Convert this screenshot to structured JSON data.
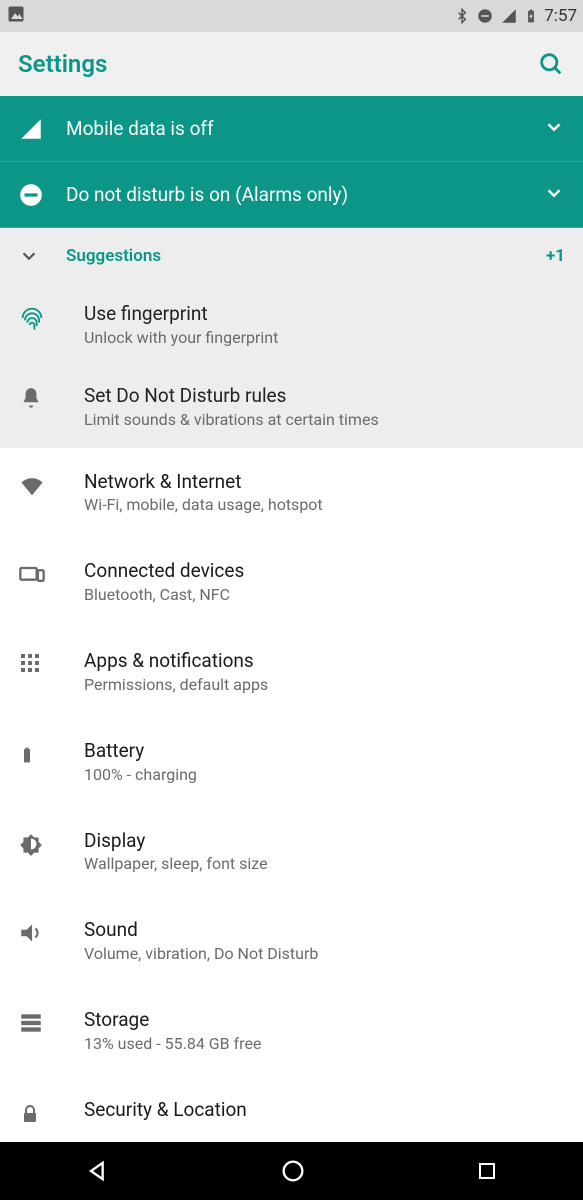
{
  "status": {
    "time": "7:57"
  },
  "header": {
    "title": "Settings"
  },
  "banners": [
    {
      "text": "Mobile data is off"
    },
    {
      "text": "Do not disturb is on (Alarms only)"
    }
  ],
  "suggestions": {
    "label": "Suggestions",
    "more": "+1",
    "items": [
      {
        "title": "Use fingerprint",
        "subtitle": "Unlock with your fingerprint"
      },
      {
        "title": "Set Do Not Disturb rules",
        "subtitle": "Limit sounds & vibrations at certain times"
      }
    ]
  },
  "settings": [
    {
      "title": "Network & Internet",
      "subtitle": "Wi-Fi, mobile, data usage, hotspot"
    },
    {
      "title": "Connected devices",
      "subtitle": "Bluetooth, Cast, NFC"
    },
    {
      "title": "Apps & notifications",
      "subtitle": "Permissions, default apps"
    },
    {
      "title": "Battery",
      "subtitle": "100% - charging"
    },
    {
      "title": "Display",
      "subtitle": "Wallpaper, sleep, font size"
    },
    {
      "title": "Sound",
      "subtitle": "Volume, vibration, Do Not Disturb"
    },
    {
      "title": "Storage",
      "subtitle": "13% used - 55.84 GB free"
    },
    {
      "title": "Security & Location",
      "subtitle": ""
    }
  ],
  "colors": {
    "accent": "#0b9688"
  }
}
